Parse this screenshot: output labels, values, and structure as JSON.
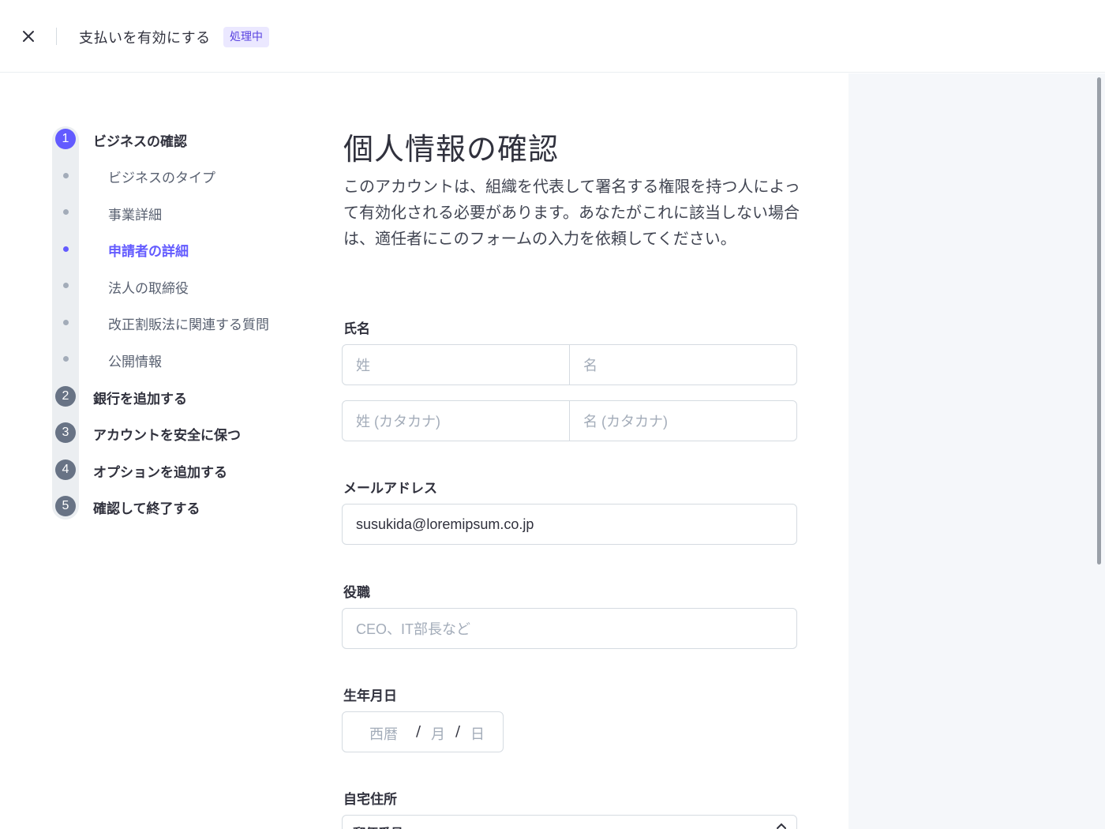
{
  "header": {
    "title": "支払いを有効にする",
    "status_badge": "処理中",
    "close_icon": "close-icon"
  },
  "stepper": {
    "steps": [
      {
        "number": "1",
        "label": "ビジネスの確認",
        "state": "active"
      },
      {
        "number": "2",
        "label": "銀行を追加する",
        "state": "pending"
      },
      {
        "number": "3",
        "label": "アカウントを安全に保つ",
        "state": "pending"
      },
      {
        "number": "4",
        "label": "オプションを追加する",
        "state": "pending"
      },
      {
        "number": "5",
        "label": "確認して終了する",
        "state": "pending"
      }
    ],
    "substeps": [
      {
        "label": "ビジネスのタイプ",
        "state": "done"
      },
      {
        "label": "事業詳細",
        "state": "done"
      },
      {
        "label": "申請者の詳細",
        "state": "active"
      },
      {
        "label": "法人の取締役",
        "state": "pending"
      },
      {
        "label": "改正割販法に関連する質問",
        "state": "pending"
      },
      {
        "label": "公開情報",
        "state": "pending"
      }
    ]
  },
  "form": {
    "heading": "個人情報の確認",
    "description": "このアカウントは、組織を代表して署名する権限を持つ人によって有効化される必要があります。あなたがこれに該当しない場合は、適任者にこのフォームの入力を依頼してください。",
    "name": {
      "label": "氏名",
      "last_name_placeholder": "姓",
      "first_name_placeholder": "名",
      "last_name_kana_placeholder": "姓 (カタカナ)",
      "first_name_kana_placeholder": "名 (カタカナ)"
    },
    "email": {
      "label": "メールアドレス",
      "value": "susukida@loremipsum.co.jp"
    },
    "job_title": {
      "label": "役職",
      "placeholder": "CEO、IT部長など"
    },
    "birthdate": {
      "label": "生年月日",
      "year_placeholder": "西暦",
      "month_placeholder": "月",
      "day_placeholder": "日",
      "separator": "/"
    },
    "address": {
      "label": "自宅住所",
      "postal_label": "郵便番号"
    }
  },
  "colors": {
    "accent": "#635bff",
    "badge_bg": "#ebe8ff",
    "pending_step": "#687385",
    "side_panel": "#f5f7fa"
  }
}
